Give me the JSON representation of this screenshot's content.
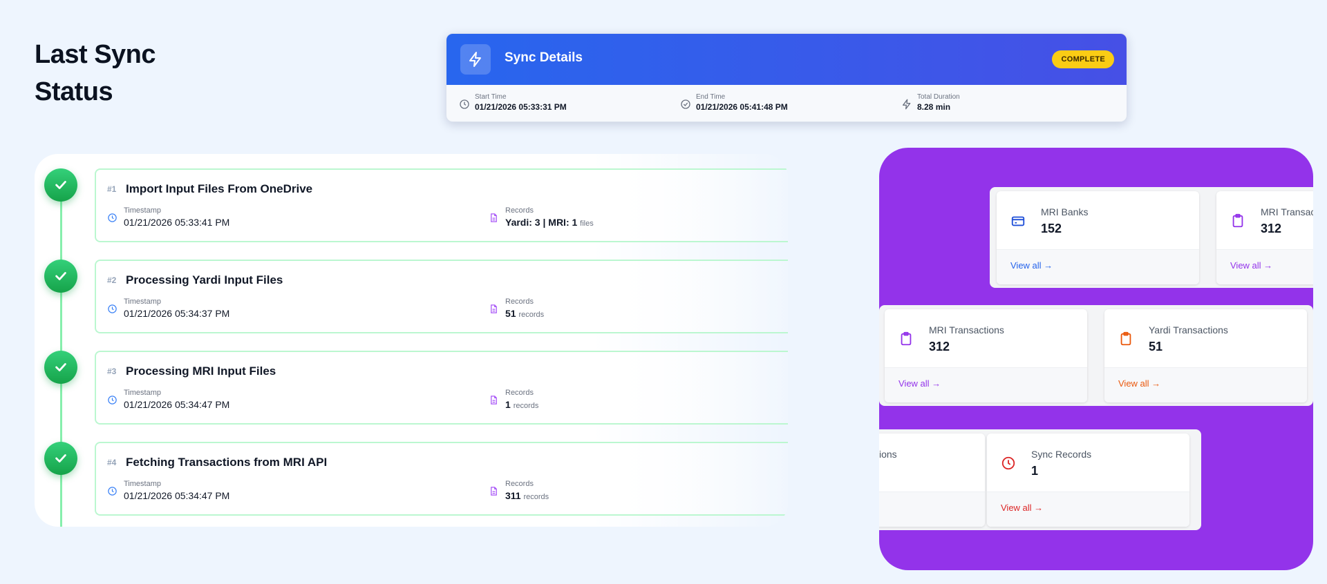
{
  "page": {
    "title": "Last Sync Status"
  },
  "sync_details": {
    "title": "Sync Details",
    "status": "COMPLETE",
    "start_label": "Start Time",
    "start_value": "01/21/2026 05:33:31 PM",
    "end_label": "End Time",
    "end_value": "01/21/2026 05:41:48 PM",
    "duration_label": "Total Duration",
    "duration_value": "8.28 min"
  },
  "steps": [
    {
      "num": "#1",
      "title": "Import Input Files From OneDrive",
      "ts_label": "Timestamp",
      "ts_value": "01/21/2026 05:33:41 PM",
      "rec_label": "Records",
      "rec_value": "Yardi: 3 | MRI: 1",
      "rec_unit": "files"
    },
    {
      "num": "#2",
      "title": "Processing Yardi Input Files",
      "ts_label": "Timestamp",
      "ts_value": "01/21/2026 05:34:37 PM",
      "rec_label": "Records",
      "rec_value": "51",
      "rec_unit": "records"
    },
    {
      "num": "#3",
      "title": "Processing MRI Input Files",
      "ts_label": "Timestamp",
      "ts_value": "01/21/2026 05:34:47 PM",
      "rec_label": "Records",
      "rec_value": "1",
      "rec_unit": "records"
    },
    {
      "num": "#4",
      "title": "Fetching Transactions from MRI API",
      "ts_label": "Timestamp",
      "ts_value": "01/21/2026 05:34:47 PM",
      "rec_label": "Records",
      "rec_value": "311",
      "rec_unit": "records"
    }
  ],
  "stats": {
    "row1": [
      {
        "name": "MRI Banks",
        "value": "152",
        "link": "View all →",
        "color": "#1d4ed8",
        "icon": "credit-card-icon"
      },
      {
        "name": "MRI Transac",
        "value": "312",
        "link": "View all →",
        "color": "#9333ea",
        "icon": "clipboard-icon"
      }
    ],
    "row2": [
      {
        "name": "MRI Transactions",
        "value": "312",
        "link": "View all →",
        "color": "#9333ea",
        "icon": "clipboard-icon"
      },
      {
        "name": "Yardi Transactions",
        "value": "51",
        "link": "View all →",
        "color": "#ea580c",
        "icon": "clipboard-icon"
      }
    ],
    "row3": [
      {
        "name": "ions",
        "value": "",
        "link": "",
        "color": "#9333ea",
        "icon": ""
      },
      {
        "name": "Sync Records",
        "value": "1",
        "link": "View all →",
        "color": "#dc2626",
        "icon": "clock-icon"
      }
    ]
  },
  "colors": {
    "accent_blue": "#2563eb",
    "success_green": "#22c55e",
    "stats_purple": "#9333ea",
    "badge_yellow": "#facc15"
  }
}
